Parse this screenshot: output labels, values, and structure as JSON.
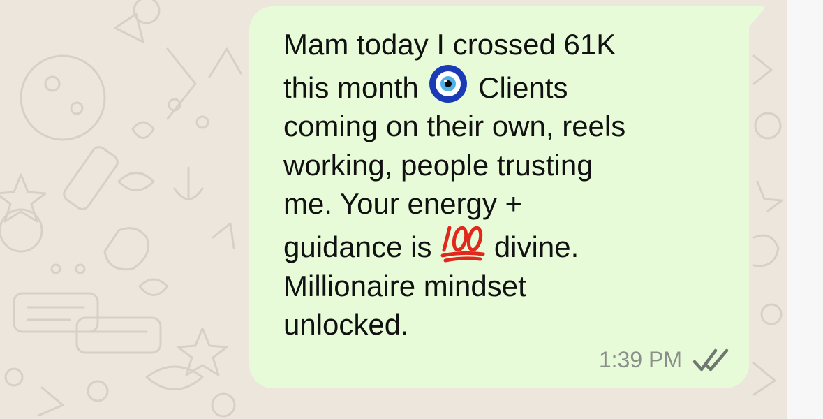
{
  "message": {
    "line_1": "Mam today I crossed 61K",
    "line_2_before_emoji": "this month ",
    "line_2_after_emoji": " Clients",
    "line_3": "coming on their own, reels",
    "line_4": "working, people trusting",
    "line_5": "me. Your energy +",
    "line_6_before_emoji": "guidance is ",
    "line_6_after_emoji": " divine.",
    "line_7": "Millionaire mindset",
    "line_8": "unlocked.",
    "emoji_1": "nazar-amulet-emoji",
    "emoji_2": "hundred-points-emoji",
    "timestamp": "1:39 PM",
    "status_icon": "double-check-read-icon"
  },
  "colors": {
    "chat_background": "#ede6dd",
    "bubble_background": "#e7fbd9",
    "text": "#111111",
    "timestamp": "#8a8f89",
    "ticks": "#707670",
    "hundred_emoji": "#e0281d"
  }
}
